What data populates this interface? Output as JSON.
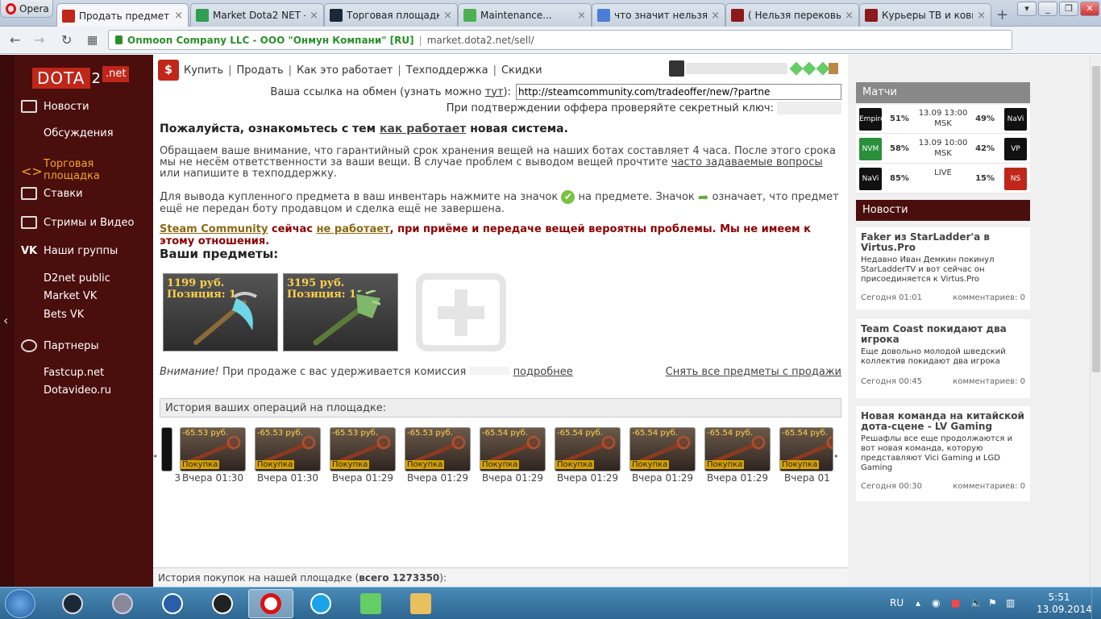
{
  "browser": {
    "menu_label": "Opera",
    "tabs": [
      {
        "title": "Продать предметы | ",
        "favicon_color": "#c0261a",
        "active": true
      },
      {
        "title": "Market Dota2 NET - ",
        "favicon_color": "#2e9e4f",
        "active": false
      },
      {
        "title": "Торговая площадка ",
        "favicon_color": "#1b2838",
        "active": false
      },
      {
        "title": "Maintenance...",
        "favicon_color": "#4caf50",
        "active": false
      },
      {
        "title": "что значит нельзя п",
        "favicon_color": "#4a7fd8",
        "active": false
      },
      {
        "title": "( Нельзя перековыв",
        "favicon_color": "#8b1a1a",
        "active": false
      },
      {
        "title": "Курьеры ТВ и ковка",
        "favicon_color": "#8b1a1a",
        "active": false
      }
    ],
    "close_glyph": "×",
    "new_tab_glyph": "+",
    "address": {
      "org": "Onmoon Company LLC - ООО \"Онмун Компани\" [RU]",
      "url": "market.dota2.net/sell/"
    }
  },
  "sidebar": {
    "logo_dota": "DOTA",
    "logo_two": "2",
    "logo_net": ".net",
    "items": [
      {
        "label": "Новости",
        "icon": "news-icon"
      },
      {
        "label": "Обсуждения",
        "icon": ""
      },
      {
        "label": "Торговая площадка",
        "icon": "trade-icon",
        "active": true
      },
      {
        "label": "Ставки",
        "icon": "bets-icon"
      },
      {
        "label": "Стримы и Видео",
        "icon": "tv-icon"
      },
      {
        "label": "Наши группы",
        "icon": "vk-icon"
      },
      {
        "label": "D2net public",
        "icon": ""
      },
      {
        "label": "Market VK",
        "icon": ""
      },
      {
        "label": "Bets VK",
        "icon": ""
      },
      {
        "label": "Партнеры",
        "icon": "handshake-icon"
      },
      {
        "label": "Fastcup.net",
        "icon": ""
      },
      {
        "label": "Dotavideo.ru",
        "icon": ""
      }
    ],
    "vk_label": "VK"
  },
  "topnav": {
    "buy": "Купить",
    "sell": "Продать",
    "how": "Как это работает",
    "support": "Техподдержка",
    "discounts": "Скидки",
    "sep": "|"
  },
  "tradelink": {
    "label_before": "Ваша ссылка на обмен (узнать можно",
    "link": "тут",
    "label_after": "):",
    "value": "http://steamcommunity.com/tradeoffer/new/?partne"
  },
  "secret_label": "При подтверждении оффера проверяйте секретный ключ:",
  "intro": {
    "before": "Пожалуйста, ознакомьтесь с тем",
    "link": "как работает",
    "after": "новая система."
  },
  "para1": {
    "text": "Обращаем ваше внимание, что гарантийный срок хранения вещей на наших ботах составляет 4 часа. После этого срока мы не несём ответственности за ваши вещи. В случае проблем с выводом вещей прочтите",
    "link": "часто задаваемые вопросы",
    "after": "или напишите в техподдержку."
  },
  "para2": {
    "before": "Для вывода купленного предмета в ваш инвентарь нажмите на значок",
    "middle": "на предмете. Значок",
    "after": "означает, что предмет ещё не передан боту продавцом и сделка ещё не завершена."
  },
  "warning": {
    "steam": "Steam Community",
    "now": "сейчас",
    "not_working": "не работает",
    "rest": ", при приёме и передаче вещей вероятны проблемы. Мы не имеем к этому отношения."
  },
  "items_title": "Ваши предметы:",
  "items": [
    {
      "price": "1199 руб.",
      "position": "Позиция: 1",
      "color": "#6fd6e8"
    },
    {
      "price": "3195 руб.",
      "position": "Позиция: 1",
      "color": "#7fb86a"
    }
  ],
  "commission": {
    "warn": "Внимание!",
    "text": "При продаже с вас удерживается комиссия",
    "more": "подробнее"
  },
  "remove_all": "Снять все предметы с продажи",
  "history": {
    "title": "История ваших операций на площадке:",
    "partial_time": "3",
    "entries": [
      {
        "price": "-65.53 руб.",
        "type": "Покупка",
        "time": "Вчера 01:30"
      },
      {
        "price": "-65.53 руб.",
        "type": "Покупка",
        "time": "Вчера 01:30"
      },
      {
        "price": "-65.53 руб.",
        "type": "Покупка",
        "time": "Вчера 01:29"
      },
      {
        "price": "-65.53 руб.",
        "type": "Покупка",
        "time": "Вчера 01:29"
      },
      {
        "price": "-65.54 руб.",
        "type": "Покупка",
        "time": "Вчера 01:29"
      },
      {
        "price": "-65.54 руб.",
        "type": "Покупка",
        "time": "Вчера 01:29"
      },
      {
        "price": "-65.54 руб.",
        "type": "Покупка",
        "time": "Вчера 01:29"
      },
      {
        "price": "-65.54 руб.",
        "type": "Покупка",
        "time": "Вчера 01:29"
      },
      {
        "price": "-65.54 руб.",
        "type": "Покупка",
        "time": "Вчера 01"
      }
    ]
  },
  "footer": {
    "text": "История покупок на нашей площадке (",
    "total_label": "всего 1273350",
    "close": "):"
  },
  "matches": {
    "title": "Матчи",
    "rows": [
      {
        "team1": "Empire",
        "p1": "51%",
        "time": "13.09 13:00 MSK",
        "p2": "49%",
        "team2": "NaVi"
      },
      {
        "team1": "NVM",
        "p1": "58%",
        "time": "13.09 10:00 MSK",
        "p2": "42%",
        "team2": "VP"
      },
      {
        "team1": "NaVi",
        "p1": "85%",
        "time": "LIVE",
        "p2": "15%",
        "team2": "NS"
      }
    ]
  },
  "news": {
    "title": "Новости",
    "items": [
      {
        "title": "Faker из StarLadder'a в Virtus.Pro",
        "desc": "Недавно Иван Демкин покинул StarLadderTV и вот сейчас он присоединяется к Virtus.Pro",
        "date": "Сегодня 01:01",
        "comments": "комментариев: 0"
      },
      {
        "title": "Team Coast покидают два игрока",
        "desc": "Еще довольно молодой шведский коллектив покидают два игрока",
        "date": "Сегодня 00:45",
        "comments": "комментариев: 0"
      },
      {
        "title": "Новая команда на китайской дота-сцене - LV Gaming",
        "desc": "Решафлы все еще продолжаются и вот новая команда, которую представляют Vici Gaming и LGD Gaming",
        "date": "Сегодня 00:30",
        "comments": "комментариев: 0"
      }
    ]
  },
  "taskbar": {
    "lang": "RU",
    "time": "5:51",
    "date": "13.09.2014"
  }
}
